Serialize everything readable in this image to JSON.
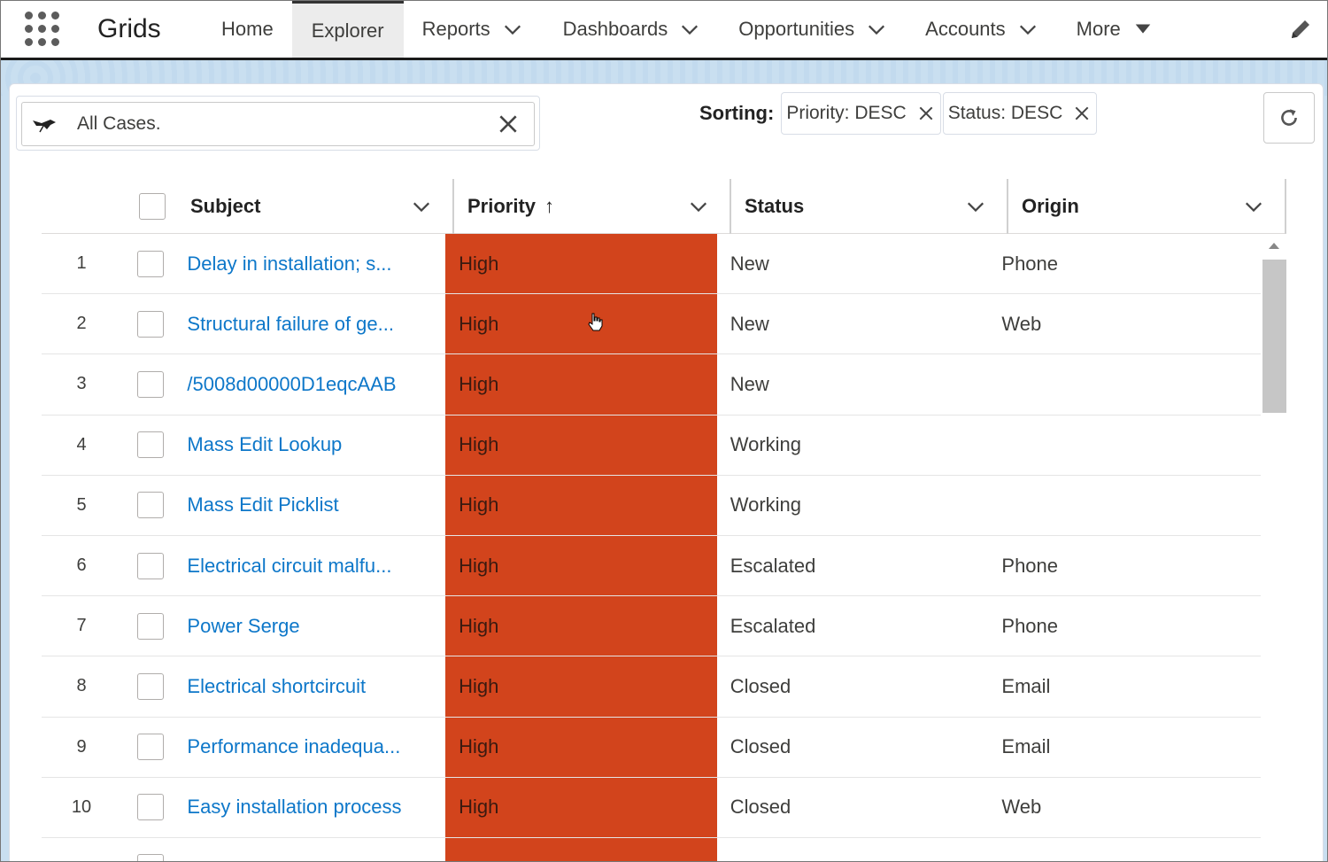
{
  "app": {
    "name": "Grids"
  },
  "nav": {
    "items": [
      {
        "label": "Home",
        "has_menu": false
      },
      {
        "label": "Explorer",
        "has_menu": false,
        "active": true
      },
      {
        "label": "Reports",
        "has_menu": true
      },
      {
        "label": "Dashboards",
        "has_menu": true
      },
      {
        "label": "Opportunities",
        "has_menu": true
      },
      {
        "label": "Accounts",
        "has_menu": true
      },
      {
        "label": "More",
        "has_menu": true
      }
    ],
    "icons": {
      "launcher": "app-launcher-icon",
      "edit": "pencil-icon"
    }
  },
  "filter": {
    "text": "All Cases.",
    "icon": "filter-bird-icon",
    "clear_icon": "close-icon"
  },
  "sorting": {
    "label": "Sorting:",
    "pills": [
      {
        "label": "Priority: DESC"
      },
      {
        "label": "Status: DESC"
      }
    ]
  },
  "refresh": {
    "icon": "refresh-icon"
  },
  "table": {
    "columns": [
      {
        "label": "Subject",
        "sort_indicator": ""
      },
      {
        "label": "Priority",
        "sort_indicator": "↑"
      },
      {
        "label": "Status",
        "sort_indicator": ""
      },
      {
        "label": "Origin",
        "sort_indicator": ""
      }
    ],
    "rows": [
      {
        "n": "1",
        "subject": "Delay in installation; s...",
        "priority": "High",
        "status": "New",
        "origin": "Phone"
      },
      {
        "n": "2",
        "subject": "Structural failure of ge...",
        "priority": "High",
        "status": "New",
        "origin": "Web"
      },
      {
        "n": "3",
        "subject": "/5008d00000D1eqcAAB",
        "priority": "High",
        "status": "New",
        "origin": ""
      },
      {
        "n": "4",
        "subject": "Mass Edit Lookup",
        "priority": "High",
        "status": "Working",
        "origin": ""
      },
      {
        "n": "5",
        "subject": "Mass Edit Picklist",
        "priority": "High",
        "status": "Working",
        "origin": ""
      },
      {
        "n": "6",
        "subject": "Electrical circuit malfu...",
        "priority": "High",
        "status": "Escalated",
        "origin": "Phone"
      },
      {
        "n": "7",
        "subject": "Power Serge",
        "priority": "High",
        "status": "Escalated",
        "origin": "Phone"
      },
      {
        "n": "8",
        "subject": "Electrical shortcircuit",
        "priority": "High",
        "status": "Closed",
        "origin": "Email"
      },
      {
        "n": "9",
        "subject": "Performance inadequa...",
        "priority": "High",
        "status": "Closed",
        "origin": "Email"
      },
      {
        "n": "10",
        "subject": "Easy installation process",
        "priority": "High",
        "status": "Closed",
        "origin": "Web"
      }
    ]
  },
  "colors": {
    "priority_high": "#d2441c",
    "link": "#0d77c9",
    "background": "#c9dff0"
  }
}
